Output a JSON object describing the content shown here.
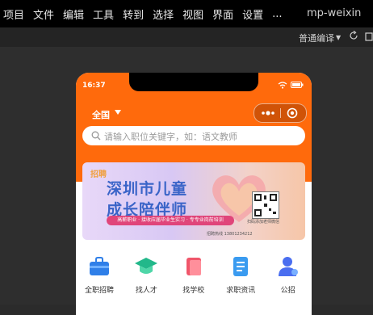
{
  "menubar": {
    "items": [
      "项目",
      "文件",
      "编辑",
      "工具",
      "转到",
      "选择",
      "视图",
      "界面",
      "设置",
      "..."
    ],
    "app_title": "mp-weixin"
  },
  "toolbar": {
    "compile_mode": "普通编译",
    "refresh_icon": "refresh-icon",
    "clear_icon": "clear-cache-icon"
  },
  "phone": {
    "status_time": "16:37",
    "region": "全国",
    "search_placeholder": "请输入职位关键字，如：语文教师",
    "accent_color": "#ff6a0c"
  },
  "banner": {
    "tag": "招聘",
    "line1": "深圳市儿童",
    "line2": "成长陪伴师",
    "ribbon": "高薪职业 · 接收应届毕业生实习 · 专专业岗前培训",
    "qr_label": "扫码添加老师微信",
    "contact": "招聘热线 13801234212"
  },
  "categories": [
    {
      "label": "全职招聘",
      "color": "#2f7fe8",
      "icon": "briefcase-icon"
    },
    {
      "label": "找人才",
      "color": "#22b88a",
      "icon": "graduation-cap-icon"
    },
    {
      "label": "找学校",
      "color": "#f0566a",
      "icon": "school-book-icon"
    },
    {
      "label": "求职资讯",
      "color": "#3a9bf0",
      "icon": "news-icon"
    },
    {
      "label": "公招",
      "color": "#4a6ef0",
      "icon": "person-icon"
    }
  ]
}
